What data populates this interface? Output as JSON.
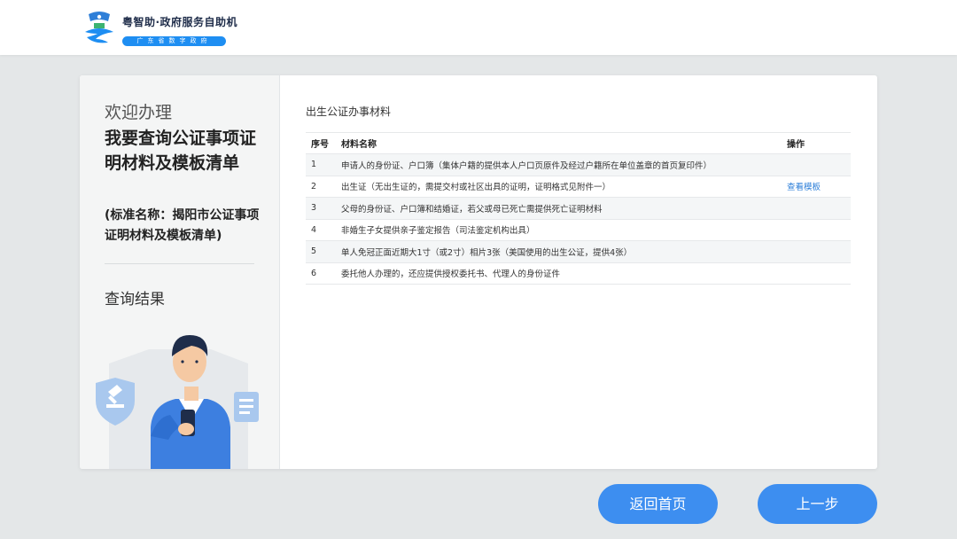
{
  "header": {
    "brand_title": "粤智助·政府服务自助机",
    "brand_subtitle": "广东省数字政府"
  },
  "left": {
    "welcome": "欢迎办理",
    "heading": "我要查询公证事项证明材料及模板清单",
    "standard_name": "(标准名称：揭阳市公证事项证明材料及模板清单)",
    "result_title": "查询结果"
  },
  "content": {
    "section_title": "出生公证办事材料",
    "table": {
      "headers": [
        "序号",
        "材料名称",
        "操作"
      ],
      "rows": [
        {
          "no": "1",
          "name": "申请人的身份证、户口簿（集体户籍的提供本人户口页原件及经过户籍所在单位盖章的首页复印件）",
          "action": ""
        },
        {
          "no": "2",
          "name": "出生证（无出生证的，需提交村或社区出具的证明，证明格式见附件一）",
          "action": "查看模板"
        },
        {
          "no": "3",
          "name": "父母的身份证、户口簿和结婚证，若父或母已死亡需提供死亡证明材料",
          "action": ""
        },
        {
          "no": "4",
          "name": "非婚生子女提供亲子鉴定报告（司法鉴定机构出具）",
          "action": ""
        },
        {
          "no": "5",
          "name": "单人免冠正面近期大1寸（或2寸）相片3张（美国使用的出生公证，提供4张）",
          "action": ""
        },
        {
          "no": "6",
          "name": "委托他人办理的，还应提供授权委托书、代理人的身份证件",
          "action": ""
        }
      ]
    }
  },
  "buttons": {
    "home": "返回首页",
    "prev": "上一步"
  },
  "colors": {
    "accent": "#3d8ef0",
    "link": "#2b7ed8",
    "brand_blue": "#1e8ef2",
    "brand_green": "#3cb371"
  },
  "icons": [
    "brand-logo-icon",
    "shield-gavel-icon",
    "document-icon",
    "person-with-phone-illustration"
  ]
}
